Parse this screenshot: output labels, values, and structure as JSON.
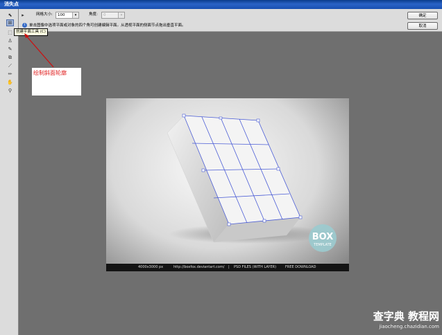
{
  "window": {
    "title": "消失点"
  },
  "options": {
    "grid_size_label": "网格大小:",
    "grid_size_value": "100",
    "angle_label": "角度:",
    "angle_value": "0",
    "hint": "单击图像中选项平面或对象的四个角可创建编辑平面。从透视平面的侧面节点拖出垂直平面。",
    "ok_label": "确定",
    "cancel_label": "取消"
  },
  "tools": [
    {
      "name": "edit-plane-tool",
      "glyph": "⬉"
    },
    {
      "name": "create-plane-tool",
      "glyph": "⊞",
      "active": true
    },
    {
      "name": "marquee-tool",
      "glyph": "⬚"
    },
    {
      "name": "stamp-tool",
      "glyph": "♙"
    },
    {
      "name": "brush-tool",
      "glyph": "✎"
    },
    {
      "name": "transform-tool",
      "glyph": "⧉"
    },
    {
      "name": "eyedropper-tool",
      "glyph": "⟋"
    },
    {
      "name": "measure-tool",
      "glyph": "✏"
    },
    {
      "name": "hand-tool",
      "glyph": "✋"
    },
    {
      "name": "zoom-tool",
      "glyph": "🔍"
    }
  ],
  "tooltip": "创建平面工具 (C)",
  "annotation": "绘制斜面轮廓",
  "image": {
    "logo_top": "BOX",
    "logo_bottom": "TEMPLATE",
    "strip": [
      "4000x3000 px",
      "http://boxfox.deviantart.com/",
      "|",
      "PSD FILES (WITH LAYER)",
      "FREE DOWNLOAD"
    ]
  },
  "watermark": {
    "line1": "查字典 教程网",
    "line2": "jiaocheng.chazidian.com"
  },
  "colors": {
    "titlebar": "#184fb0",
    "grid": "#4a5cd6",
    "annotation_text": "#e02020",
    "arrow": "#cc1010"
  }
}
